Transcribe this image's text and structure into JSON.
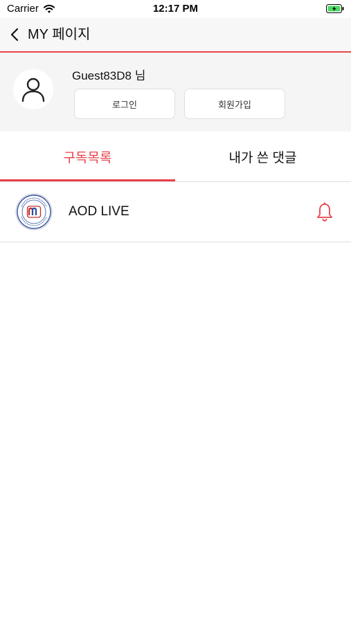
{
  "status_bar": {
    "carrier": "Carrier",
    "time": "12:17 PM",
    "wifi_icon": "wifi-icon",
    "battery_icon": "battery-charging-icon"
  },
  "nav": {
    "back_icon": "chevron-left-icon",
    "title": "MY 페이지",
    "accent": "#e8424a"
  },
  "profile": {
    "avatar_icon": "user-icon",
    "name": "Guest83D8 님",
    "login_label": "로그인",
    "signup_label": "회원가입"
  },
  "tabs": [
    {
      "label": "구독목록",
      "active": true
    },
    {
      "label": "내가 쓴 댓글",
      "active": false
    }
  ],
  "subscriptions": [
    {
      "name": "AOD LIVE",
      "logo_icon": "seminary-seal-logo",
      "bell_icon": "bell-icon"
    }
  ]
}
